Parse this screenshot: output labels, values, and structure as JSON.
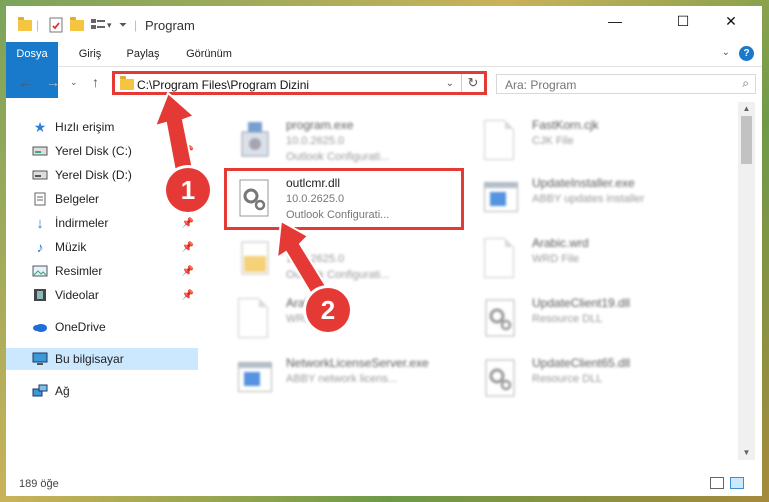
{
  "window": {
    "title": "Program",
    "controls": {
      "minimize": "—",
      "maximize": "☐",
      "close": "✕"
    }
  },
  "ribbon": {
    "tabs": [
      "Dosya",
      "Giriş",
      "Paylaş",
      "Görünüm"
    ],
    "help": "?"
  },
  "nav": {
    "address": "C:\\Program Files\\Program Dizini",
    "search_placeholder": "Ara: Program"
  },
  "sidebar": {
    "items": [
      {
        "label": "Hızlı erişim",
        "icon": "star-icon"
      },
      {
        "label": "Yerel Disk (C:)",
        "icon": "drive-icon"
      },
      {
        "label": "Yerel Disk (D:)",
        "icon": "drive-icon"
      },
      {
        "label": "Belgeler",
        "icon": "documents-icon"
      },
      {
        "label": "İndirmeler",
        "icon": "download-icon"
      },
      {
        "label": "Müzik",
        "icon": "music-icon"
      },
      {
        "label": "Resimler",
        "icon": "pictures-icon"
      },
      {
        "label": "Videolar",
        "icon": "video-icon"
      },
      {
        "label": "OneDrive",
        "icon": "cloud-icon"
      },
      {
        "label": "Bu bilgisayar",
        "icon": "computer-icon"
      },
      {
        "label": "Ağ",
        "icon": "network-icon"
      }
    ]
  },
  "files": [
    {
      "name": "program.exe",
      "line1": "10.0.2625.0",
      "line2": "Outlook Configurati...",
      "icon": "gear-file-icon"
    },
    {
      "name": "FastKorn.cjk",
      "line1": "CJK File",
      "line2": "",
      "icon": "page-icon"
    },
    {
      "name": "outlcmr.dll",
      "line1": "10.0.2625.0",
      "line2": "Outlook Configurati...",
      "icon": "dll-gear-icon"
    },
    {
      "name": "UpdateInstaller.exe",
      "line1": "ABBY updates installer",
      "line2": "",
      "icon": "exe-icon"
    },
    {
      "name": "",
      "line1": "10.0.2625.0",
      "line2": "Outlook Configurati...",
      "icon": "folder-file-icon"
    },
    {
      "name": "Arabic.wrd",
      "line1": "WRD File",
      "line2": "",
      "icon": "page-icon"
    },
    {
      "name": "Arabic",
      "line1": "WRD",
      "line2": "",
      "icon": "page-icon"
    },
    {
      "name": "UpdateClient19.dll",
      "line1": "Resource DLL",
      "line2": "",
      "icon": "dll-gear-icon"
    },
    {
      "name": "NetworkLicenseServer.exe",
      "line1": "ABBY network licens...",
      "line2": "",
      "icon": "exe-icon"
    },
    {
      "name": "UpdateClient65.dll",
      "line1": "Resource DLL",
      "line2": "",
      "icon": "dll-gear-icon"
    }
  ],
  "status": {
    "count": "189 öğe"
  },
  "callouts": [
    "1",
    "2"
  ],
  "colors": {
    "accent": "#1979ca",
    "highlight": "#e53935",
    "selected": "#cce8ff"
  }
}
